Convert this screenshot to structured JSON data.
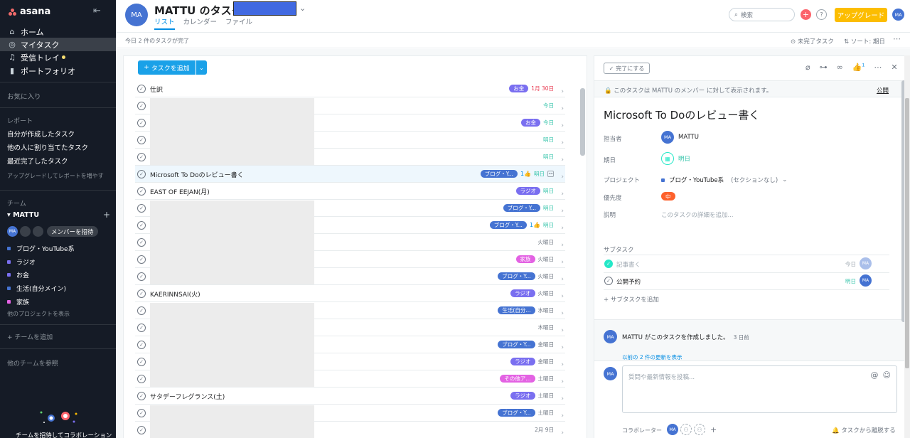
{
  "app": {
    "logo": "asana"
  },
  "sidebar": {
    "nav": [
      {
        "label": "ホーム",
        "icon": "home-icon"
      },
      {
        "label": "マイタスク",
        "icon": "check-circle-icon"
      },
      {
        "label": "受信トレイ",
        "icon": "bell-icon"
      },
      {
        "label": "ポートフォリオ",
        "icon": "bar-chart-icon"
      }
    ],
    "favorites": "お気に入り",
    "reports_head": "レポート",
    "reports": [
      "自分が作成したタスク",
      "他の人に割り当てたタスク",
      "最近完了したタスク"
    ],
    "upgrade_reports": "アップグレードしてレポートを増やす",
    "teams_head": "チーム",
    "team_name": "MATTU",
    "team_avatar": "MA",
    "invite": "メンバーを招待",
    "projects": [
      {
        "label": "ブログ・YouTube系",
        "color": "#4573d2"
      },
      {
        "label": "ラジオ",
        "color": "#7a6ff0"
      },
      {
        "label": "お金",
        "color": "#7a6ff0"
      },
      {
        "label": "生活(自分メイン)",
        "color": "#4573d2"
      },
      {
        "label": "家族",
        "color": "#e362e3"
      }
    ],
    "show_projects": "他のプロジェクトを表示",
    "add_team": "チームを追加",
    "browse_teams": "他のチームを参照",
    "bottom_text": "チームを招待してコラボレーション"
  },
  "header": {
    "avatar": "MA",
    "title": "MATTU のタスク -",
    "tabs": [
      "リスト",
      "カレンダー",
      "ファイル"
    ],
    "search_placeholder": "検索",
    "upgrade": "アップグレード",
    "me": "MA",
    "done_today": "今日 2 件のタスクが完了",
    "filter_incomplete": "未完了タスク",
    "filter_sort": "ソート: 期日"
  },
  "list": {
    "add_task": "タスクを追加",
    "rows": [
      {
        "name": "仕訳",
        "tags": [
          {
            "label": "お金",
            "color": "#7a6ff0"
          }
        ],
        "due": "1月 30日",
        "due_color": "#e8384f",
        "redacted": false
      },
      {
        "name": "",
        "tags": [],
        "due": "今日",
        "due_color": "#37c5ab",
        "redacted": true
      },
      {
        "name": "",
        "tags": [
          {
            "label": "お金",
            "color": "#7a6ff0"
          }
        ],
        "due": "今日",
        "due_color": "#37c5ab",
        "redacted": true
      },
      {
        "name": "",
        "tags": [],
        "due": "明日",
        "due_color": "#37c5ab",
        "redacted": true
      },
      {
        "name": "",
        "tags": [],
        "due": "明日",
        "due_color": "#37c5ab",
        "redacted": true
      },
      {
        "name": "Microsoft To Doのレビュー書く",
        "tags": [
          {
            "label": "ブログ・Y...",
            "color": "#4573d2"
          }
        ],
        "likes": "1",
        "subtask": true,
        "due": "明日",
        "due_color": "#37c5ab",
        "redacted": false,
        "selected": true
      },
      {
        "name": "EAST OF EEJAN(月)",
        "tags": [
          {
            "label": "ラジオ",
            "color": "#7a6ff0"
          }
        ],
        "due": "明日",
        "due_color": "#37c5ab",
        "redacted": false
      },
      {
        "name": "",
        "tags": [
          {
            "label": "ブログ・Y...",
            "color": "#4573d2"
          }
        ],
        "due": "明日",
        "due_color": "#37c5ab",
        "redacted": true
      },
      {
        "name": "",
        "tags": [
          {
            "label": "ブログ・Y...",
            "color": "#4573d2"
          }
        ],
        "likes": "1",
        "due": "明日",
        "due_color": "#37c5ab",
        "redacted": true
      },
      {
        "name": "",
        "tags": [],
        "due": "火曜日",
        "due_color": "#6f7782",
        "redacted": true
      },
      {
        "name": "",
        "tags": [
          {
            "label": "家族",
            "color": "#e362e3"
          }
        ],
        "due": "火曜日",
        "due_color": "#6f7782",
        "redacted": true
      },
      {
        "name": "",
        "tags": [
          {
            "label": "ブログ・Y...",
            "color": "#4573d2"
          }
        ],
        "due": "火曜日",
        "due_color": "#6f7782",
        "redacted": true
      },
      {
        "name": "KAERINNSAI(火)",
        "tags": [
          {
            "label": "ラジオ",
            "color": "#7a6ff0"
          }
        ],
        "due": "火曜日",
        "due_color": "#6f7782",
        "redacted": false
      },
      {
        "name": "",
        "tags": [
          {
            "label": "生活(自分...",
            "color": "#4573d2"
          }
        ],
        "due": "水曜日",
        "due_color": "#6f7782",
        "redacted": true
      },
      {
        "name": "",
        "tags": [],
        "due": "木曜日",
        "due_color": "#6f7782",
        "redacted": true
      },
      {
        "name": "",
        "tags": [
          {
            "label": "ブログ・Y...",
            "color": "#4573d2"
          }
        ],
        "due": "金曜日",
        "due_color": "#6f7782",
        "redacted": true
      },
      {
        "name": "",
        "tags": [
          {
            "label": "ラジオ",
            "color": "#7a6ff0"
          }
        ],
        "due": "金曜日",
        "due_color": "#6f7782",
        "redacted": true
      },
      {
        "name": "",
        "tags": [
          {
            "label": "その他ア...",
            "color": "#e362e3"
          }
        ],
        "due": "土曜日",
        "due_color": "#6f7782",
        "redacted": true
      },
      {
        "name": "サタデーフレグランス(土)",
        "tags": [
          {
            "label": "ラジオ",
            "color": "#7a6ff0"
          }
        ],
        "due": "土曜日",
        "due_color": "#6f7782",
        "redacted": false
      },
      {
        "name": "",
        "tags": [
          {
            "label": "ブログ・Y...",
            "color": "#4573d2"
          }
        ],
        "due": "土曜日",
        "due_color": "#6f7782",
        "redacted": true
      },
      {
        "name": "",
        "tags": [],
        "due": "2月 9日",
        "due_color": "#6f7782",
        "redacted": true
      }
    ]
  },
  "detail": {
    "complete": "完了にする",
    "like_count": "1",
    "notice": "このタスクは MATTU のメンバー に対して表示されます。",
    "public": "公開",
    "title": "Microsoft To Doのレビュー書く",
    "assignee_label": "担当者",
    "assignee": "MATTU",
    "assignee_avatar": "MA",
    "due_label": "期日",
    "due": "明日",
    "project_label": "プロジェクト",
    "project": "ブログ・YouTube系",
    "section": "(セクションなし)",
    "priority_label": "優先度",
    "priority": "中",
    "desc_label": "説明",
    "desc_placeholder": "このタスクの詳細を追加...",
    "subtasks_label": "サブタスク",
    "subtasks": [
      {
        "name": "記事書く",
        "due": "今日",
        "done": true
      },
      {
        "name": "公開予約",
        "due": "明日",
        "done": false
      }
    ],
    "add_subtask": "サブタスクを追加",
    "activity": "MATTU がこのタスクを作成しました。",
    "activity_time": "3 日前",
    "activity_more": "以前の 2 件の更新を表示",
    "comment_placeholder": "質問や最新情報を投稿...",
    "collaborators": "コラボレーター",
    "leave": "タスクから離脱する"
  }
}
